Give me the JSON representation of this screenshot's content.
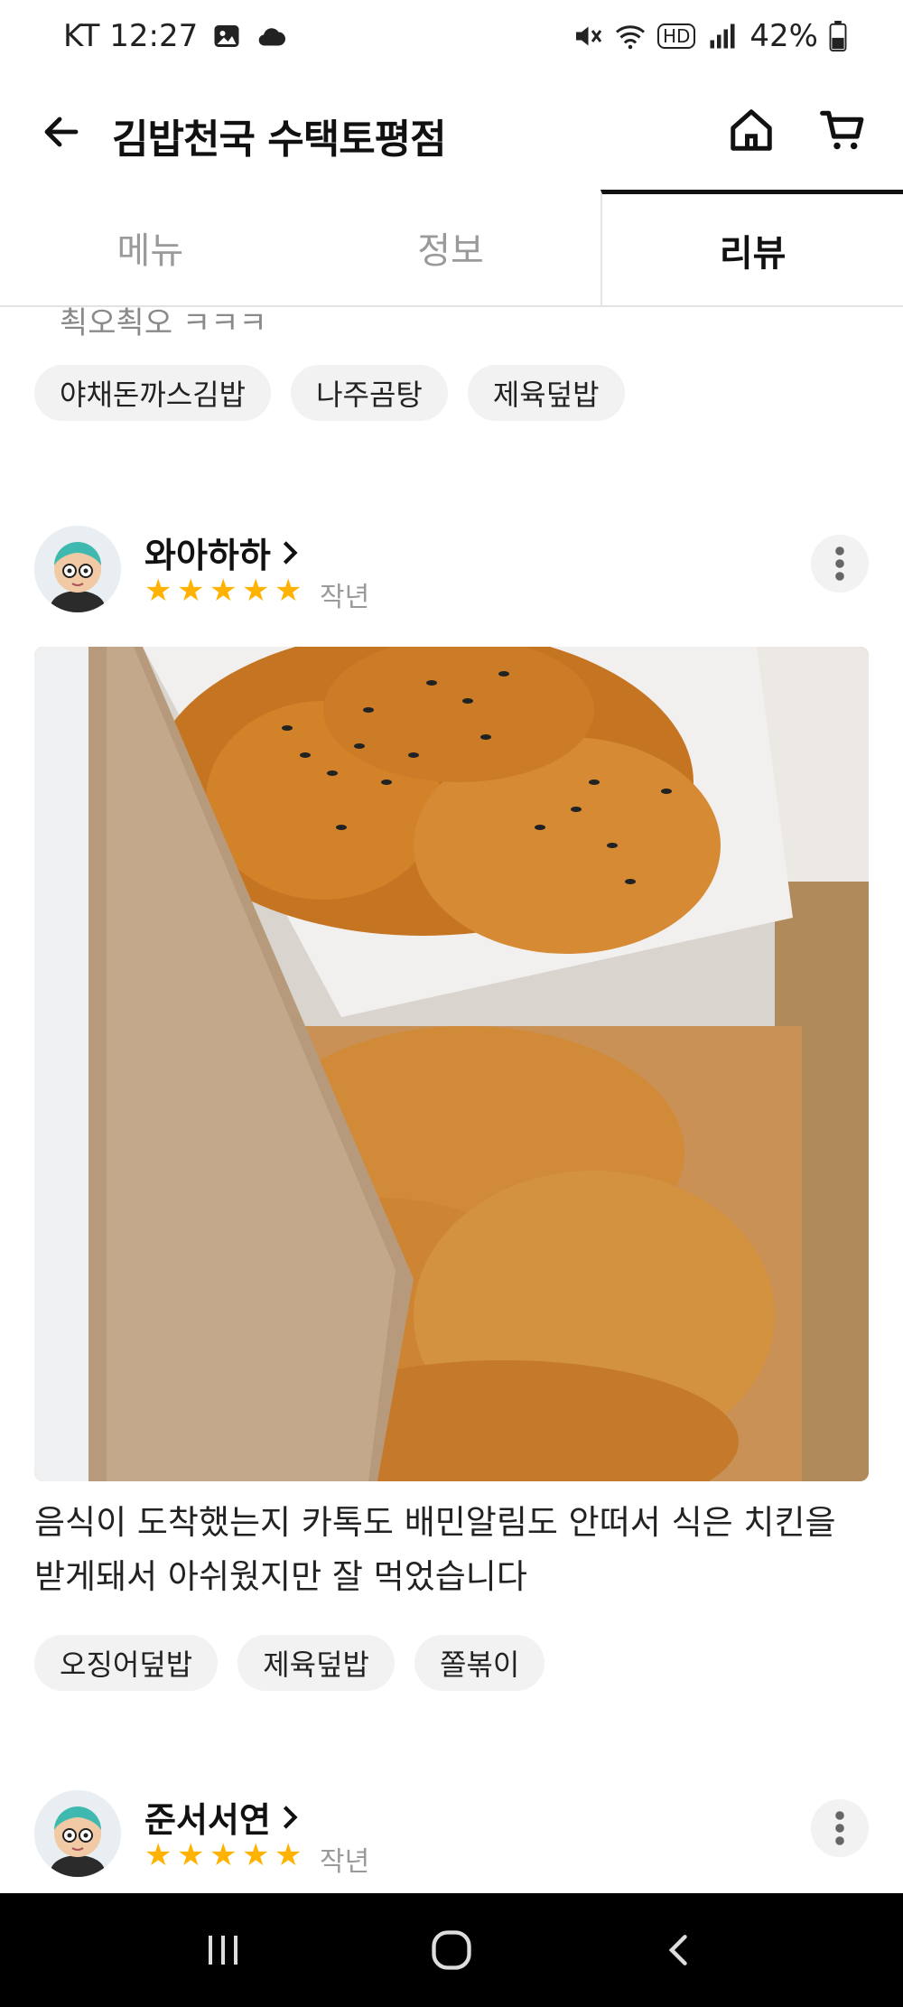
{
  "status_bar": {
    "carrier_time": "KT 12:27",
    "battery": "42%",
    "network_badge": "HD"
  },
  "header": {
    "store_name": "김밥천국 수택토평점",
    "icons": [
      "back-arrow-icon",
      "home-icon",
      "cart-icon"
    ]
  },
  "tabs": [
    {
      "label": "메뉴",
      "active": false
    },
    {
      "label": "정보",
      "active": false
    },
    {
      "label": "리뷰",
      "active": true
    }
  ],
  "previous_review": {
    "cut_text": "쵝오쵝오 ㅋㅋㅋ",
    "menu_chips": [
      "야채돈까스김밥",
      "나주곰탕",
      "제육덮밥"
    ]
  },
  "reviews": [
    {
      "reviewer": "와아하하",
      "rating": 5,
      "time": "작년",
      "text": "음식이 도착했는지 카톡도 배민알림도 안떠서 식은 치킨을 받게돼서 아쉬웠지만 잘 먹었습니다",
      "menu_chips": [
        "오징어덮밥",
        "제육덮밥",
        "쫄볶이"
      ]
    },
    {
      "reviewer": "준서서연",
      "rating": 5,
      "time": "작년"
    }
  ],
  "colors": {
    "star": "#ffb300",
    "chip_bg": "#f2f2f2",
    "nav_bg": "#000000"
  }
}
